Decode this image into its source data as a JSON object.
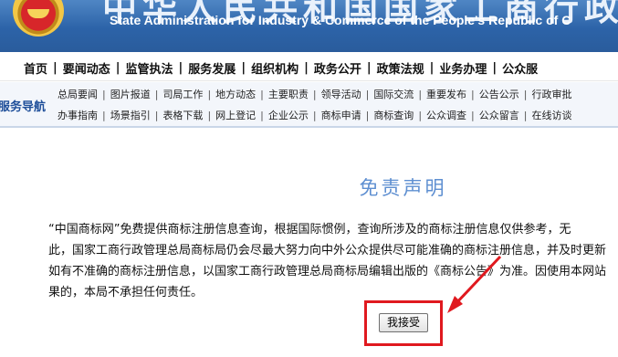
{
  "banner": {
    "title_cn": "中华人民共和国国家工商行政管理总局",
    "title_en": "State Administration for Industry & Commerce of the People's Republic of C"
  },
  "main_nav": {
    "items": [
      "首页",
      "要闻动态",
      "监管执法",
      "服务发展",
      "组织机构",
      "政务公开",
      "政策法规",
      "业务办理",
      "公众服"
    ]
  },
  "sub_nav": {
    "label": "服务导航",
    "row1": [
      "总局要闻",
      "图片报道",
      "司局工作",
      "地方动态",
      "主要职责",
      "领导活动",
      "国际交流",
      "重要发布",
      "公告公示",
      "行政审批"
    ],
    "row2": [
      "办事指南",
      "场景指引",
      "表格下载",
      "网上登记",
      "企业公示",
      "商标申请",
      "商标查询",
      "公众调查",
      "公众留言",
      "在线访谈"
    ]
  },
  "notice": {
    "heading": "免责声明",
    "lines": [
      "“中国商标网”免费提供商标注册信息查询，根据国际惯例，查询所涉及的商标注册信息仅供参考，无",
      "此，国家工商行政管理总局商标局仍会尽最大努力向中外公众提供尽可能准确的商标注册信息，并及时更新",
      "如有不准确的商标注册信息，以国家工商行政管理总局商标局编辑出版的《商标公告》为准。因使用本网站",
      "果的，本局不承担任何责任。"
    ],
    "accept_label": "我接受"
  },
  "colors": {
    "banner": "#2c63a8",
    "heading": "#5e8fd1",
    "highlight": "#e0191f"
  }
}
